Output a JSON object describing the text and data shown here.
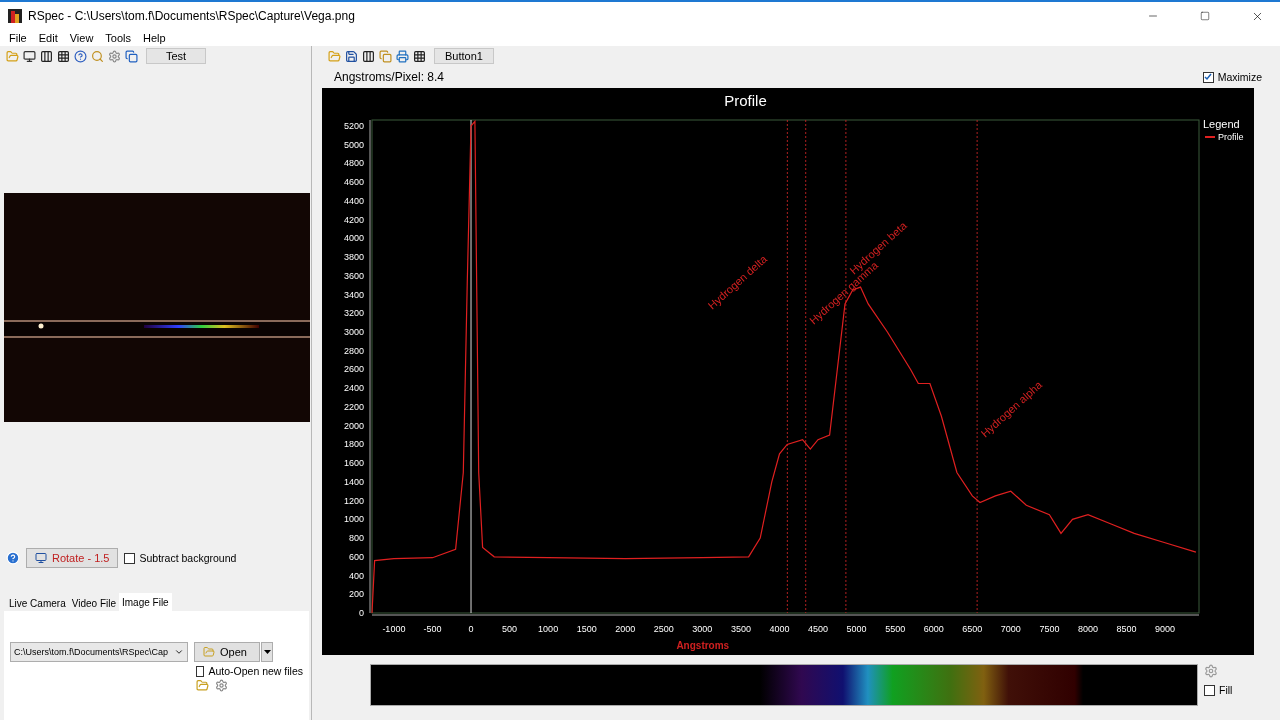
{
  "window": {
    "title": "RSpec - C:\\Users\\tom.f\\Documents\\RSpec\\Capture\\Vega.png"
  },
  "menu": [
    {
      "label": "File"
    },
    {
      "label": "Edit"
    },
    {
      "label": "View"
    },
    {
      "label": "Tools"
    },
    {
      "label": "Help"
    }
  ],
  "left_toolbar": {
    "button": "Test"
  },
  "controls": {
    "rotate_button": "Rotate - 1.5",
    "subtract_background": {
      "label": "Subtract background",
      "checked": false
    }
  },
  "tabs": [
    {
      "label": "Live Camera",
      "selected": false
    },
    {
      "label": "Video File",
      "selected": false
    },
    {
      "label": "Image File",
      "selected": true
    }
  ],
  "image_file": {
    "path": "C:\\Users\\tom.f\\Documents\\RSpec\\Cap",
    "open_button": "Open",
    "auto_open": {
      "label": "Auto-Open new files",
      "checked": false
    }
  },
  "right_toolbar": {
    "button": "Button1"
  },
  "header": {
    "scale": "Angstroms/Pixel: 8.4",
    "maximize": {
      "label": "Maximize",
      "checked": true
    }
  },
  "chart": {
    "legend_title": "Legend",
    "chart_data": {
      "type": "line",
      "title": "Profile",
      "xlabel": "Angstroms",
      "xlim": [
        -1284,
        9440
      ],
      "ylim": [
        0,
        5264
      ],
      "x": [
        -1284,
        -1250,
        -1000,
        -500,
        -200,
        -100,
        -50,
        0,
        50,
        80,
        100,
        150,
        300,
        1000,
        2000,
        3000,
        3600,
        3750,
        3900,
        4000,
        4100,
        4300,
        4400,
        4500,
        4650,
        4750,
        4850,
        4950,
        5050,
        5150,
        5400,
        5700,
        5800,
        5950,
        6100,
        6300,
        6500,
        6600,
        6800,
        7000,
        7200,
        7500,
        7650,
        7800,
        8000,
        8300,
        8600,
        9000,
        9400
      ],
      "series": [
        {
          "name": "Profile",
          "color": "#e02020",
          "values": [
            0,
            560,
            580,
            590,
            680,
            1500,
            3500,
            5200,
            5250,
            3000,
            1500,
            700,
            600,
            590,
            580,
            590,
            600,
            800,
            1400,
            1700,
            1800,
            1850,
            1750,
            1850,
            1900,
            2600,
            3300,
            3450,
            3480,
            3300,
            3000,
            2600,
            2450,
            2450,
            2100,
            1500,
            1250,
            1180,
            1250,
            1300,
            1150,
            1050,
            850,
            1000,
            1050,
            950,
            850,
            750,
            650
          ]
        }
      ],
      "xticks": [
        -1000,
        -500,
        0,
        500,
        1000,
        1500,
        2000,
        2500,
        3000,
        3500,
        4000,
        4500,
        5000,
        5500,
        6000,
        6500,
        7000,
        7500,
        8000,
        8500,
        9000
      ],
      "yticks": [
        0,
        200,
        400,
        600,
        800,
        1000,
        1200,
        1400,
        1600,
        1800,
        2000,
        2200,
        2400,
        2600,
        2800,
        3000,
        3200,
        3400,
        3600,
        3800,
        4000,
        4200,
        4400,
        4600,
        4800,
        5000,
        5200
      ],
      "ref_lines": [
        {
          "axis": "x",
          "value": 4102,
          "label": "Hydrogen delta"
        },
        {
          "axis": "x",
          "value": 4340,
          "label": "Hydrogen gamma"
        },
        {
          "axis": "x",
          "value": 4861,
          "label": "Hydrogen beta"
        },
        {
          "axis": "x",
          "value": 6563,
          "label": "Hydrogen alpha"
        }
      ]
    }
  },
  "spectrum": {
    "fill": {
      "label": "Fill",
      "checked": false
    }
  }
}
